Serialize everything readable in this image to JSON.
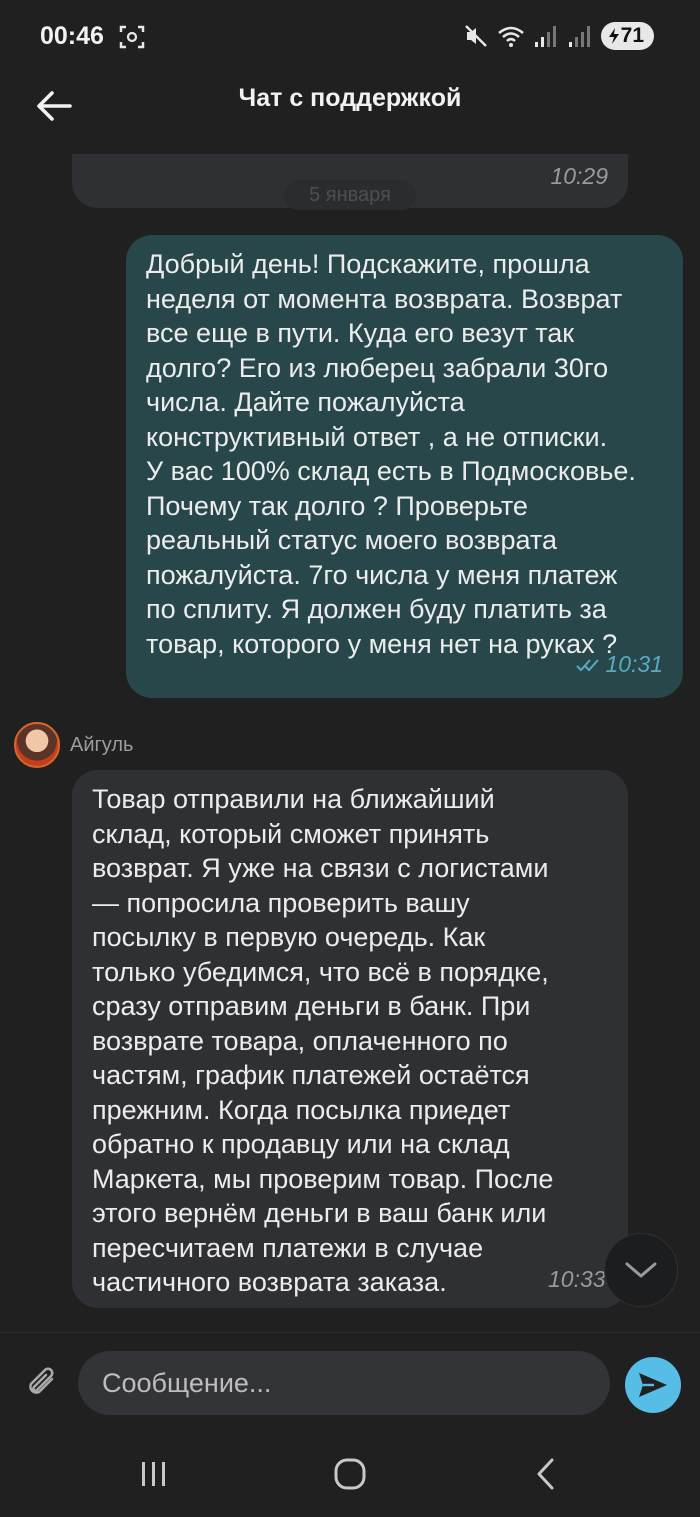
{
  "status_bar": {
    "time": "00:46",
    "battery": "71"
  },
  "header": {
    "title": "Чат с поддержкой"
  },
  "chat": {
    "date_separator": "5 января",
    "messages": [
      {
        "direction": "incoming",
        "text": "",
        "time": "10:29"
      },
      {
        "direction": "outgoing",
        "text": "Добрый день! Подскажите, прошла\nнеделя от момента возврата. Возврат\nвсе еще в пути. Куда его везут так\nдолго? Его из люберец забрали 30го\nчисла. Дайте пожалуйста\nконструктивный ответ , а не отписки.\nУ вас 100% склад есть в Подмосковье.\nПочему так долго ? Проверьте\nреальный статус моего возврата\nпожалуйста. 7го числа у меня платеж\nпо сплиту. Я должен буду платить за\nтовар, которого у меня нет на руках ?",
        "time": "10:31",
        "status": "read"
      },
      {
        "direction": "incoming",
        "sender": "Айгуль",
        "text": "Товар отправили на ближайший\nсклад, который сможет принять\nвозврат. Я уже на связи с логистами\n— попросила проверить вашу\nпосылку в первую очередь. Как\nтолько убедимся, что всё в порядке,\nсразу отправим деньги в банк. При\nвозврате товара, оплаченного по\nчастям, график платежей остаётся\nпрежним. Когда посылка приедет\nобратно к продавцу или на склад\nМаркета, мы проверим товар. После\nэтого вернём деньги в ваш банк или\nпересчитаем платежи в случае\nчастичного возврата заказа.",
        "time": "10:33"
      }
    ]
  },
  "composer": {
    "placeholder": "Сообщение..."
  },
  "icons": {
    "back": "arrow-left-icon",
    "attach": "paperclip-icon",
    "send": "send-icon",
    "scroll_down": "chevron-down-icon",
    "nav_recents": "recents-icon",
    "nav_home": "home-icon",
    "nav_back": "nav-back-icon"
  },
  "colors": {
    "background": "#202020",
    "incoming_bubble": "#2f3033",
    "outgoing_bubble": "#27474b",
    "accent": "#55bde6"
  }
}
